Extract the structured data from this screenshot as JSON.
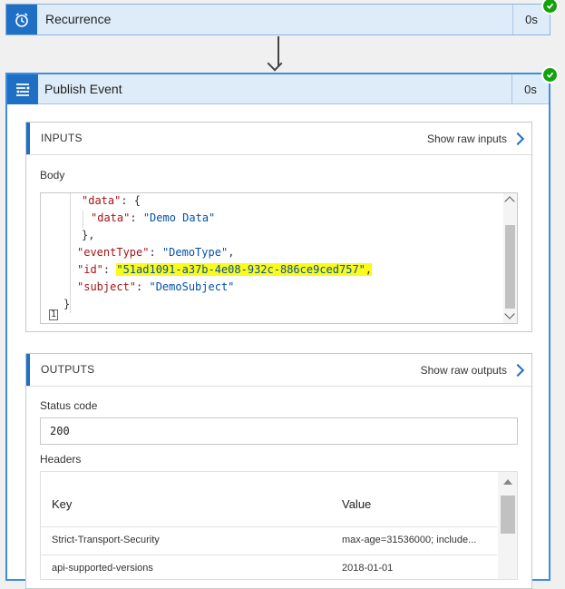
{
  "recurrence": {
    "title": "Recurrence",
    "duration": "0s"
  },
  "publish": {
    "title": "Publish Event",
    "duration": "0s",
    "inputs": {
      "heading": "INPUTS",
      "raw_link": "Show raw inputs",
      "body_label": "Body",
      "line_number": "1",
      "code": {
        "l1_key": "\"data\"",
        "l1_rest": ": {",
        "l2_key": "\"data\"",
        "l2_val": "\"Demo Data\"",
        "l3": "},",
        "l4_key": "\"eventType\"",
        "l4_val": "\"DemoType\"",
        "l5_key": "\"id\"",
        "l5_val": "\"51ad1091-a37b-4e08-932c-886ce9ced757\"",
        "l6_key": "\"subject\"",
        "l6_val": "\"DemoSubject\"",
        "l7": "}"
      }
    },
    "outputs": {
      "heading": "OUTPUTS",
      "raw_link": "Show raw outputs",
      "status_label": "Status code",
      "status_value": "200",
      "headers_label": "Headers",
      "table": {
        "col_key": "Key",
        "col_value": "Value",
        "rows": [
          {
            "key": "Strict-Transport-Security",
            "value": "max-age=31536000; include..."
          },
          {
            "key": "api-supported-versions",
            "value": "2018-01-01"
          }
        ]
      }
    }
  },
  "colors": {
    "accent": "#1f6fc5",
    "header_bg": "#deecf9",
    "success": "#13a10e",
    "highlight": "#fbfb1b"
  }
}
